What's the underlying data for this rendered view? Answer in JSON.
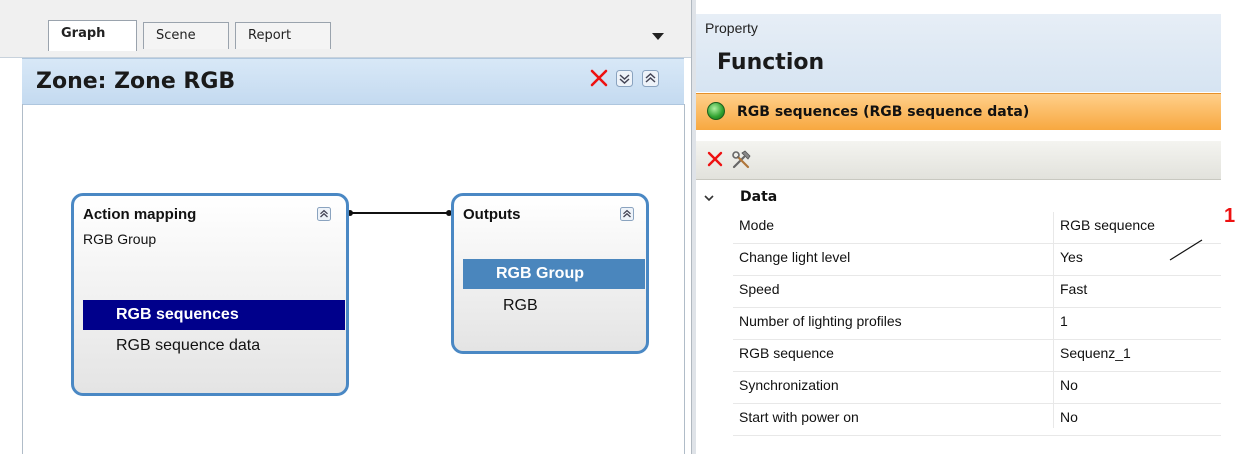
{
  "tabs": [
    {
      "label": "Graph",
      "active": true
    },
    {
      "label": "Scene",
      "active": false
    },
    {
      "label": "Report",
      "active": false
    }
  ],
  "zone": {
    "title": "Zone: Zone RGB"
  },
  "nodes": {
    "action": {
      "title": "Action mapping",
      "subtitle": "RGB Group",
      "items": [
        "RGB sequences",
        "RGB sequence data"
      ]
    },
    "outputs": {
      "title": "Outputs",
      "items": [
        "RGB Group",
        "RGB"
      ]
    }
  },
  "property": {
    "panel_label": "Property",
    "section_title": "Function",
    "selected": "RGB sequences (RGB sequence data)",
    "group_title": "Data",
    "rows": [
      {
        "name": "Mode",
        "value": "RGB sequence"
      },
      {
        "name": "Change light level",
        "value": "Yes"
      },
      {
        "name": "Speed",
        "value": "Fast"
      },
      {
        "name": "Number of lighting profiles",
        "value": "1"
      },
      {
        "name": "RGB sequence",
        "value": "Sequenz_1"
      },
      {
        "name": "Synchronization",
        "value": "No"
      },
      {
        "name": "Start with power on",
        "value": "No"
      }
    ]
  },
  "annotation": {
    "number": "1"
  },
  "colors": {
    "accent_blue": "#4a88c4",
    "selected_dark": "#00008b",
    "orange_bar": "#f7a840",
    "delete_red": "#e11"
  }
}
